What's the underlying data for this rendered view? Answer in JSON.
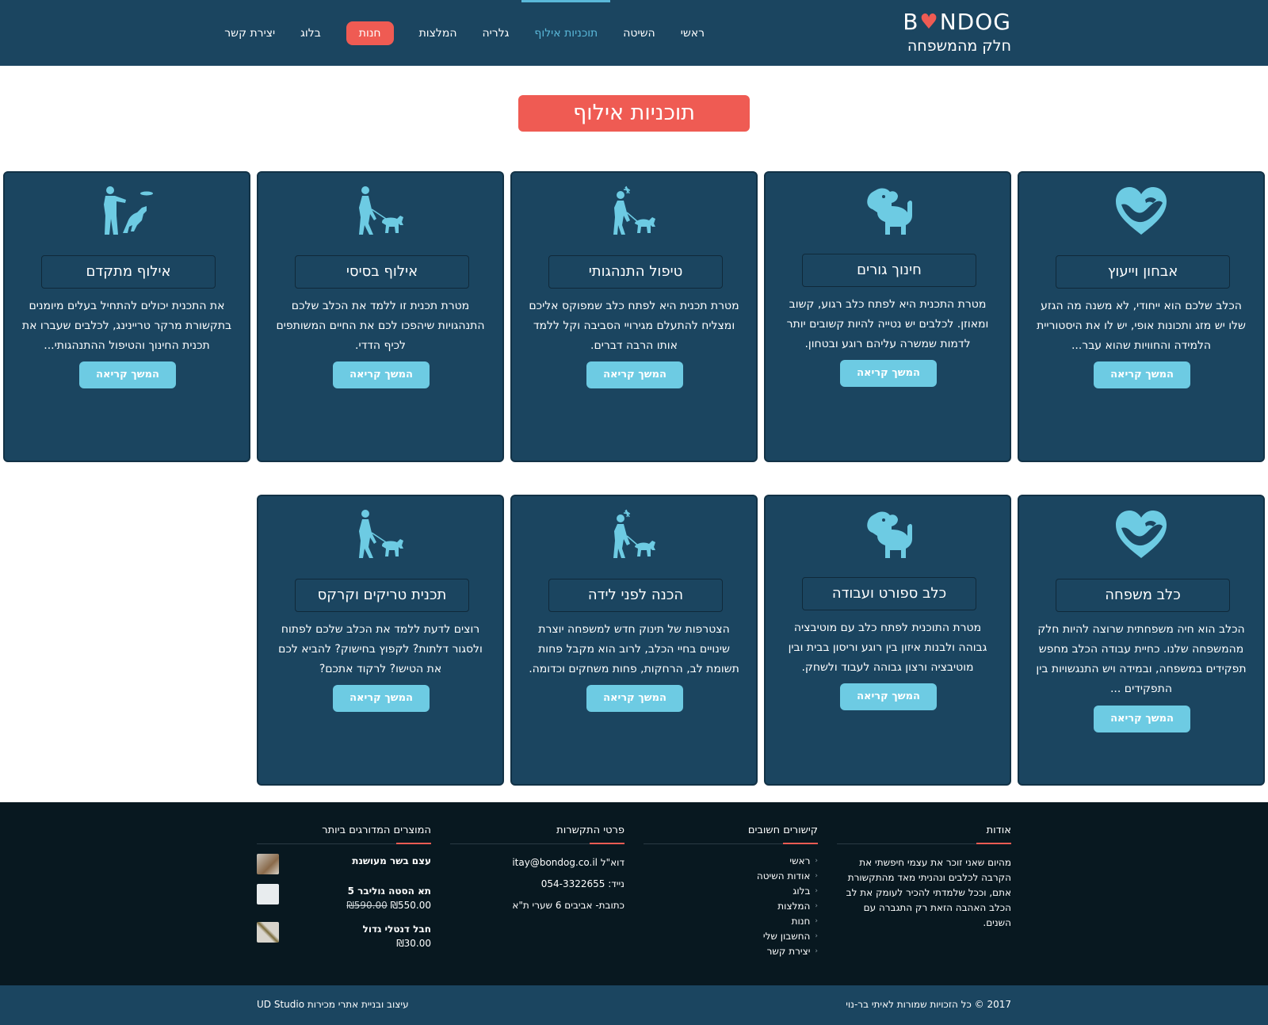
{
  "header": {
    "logo_brand_pre": "B",
    "logo_brand_post": "ND",
    "logo_brand_end": "OG",
    "logo_tagline": "חלק מהמשפחה",
    "nav": [
      {
        "label": "ראשי"
      },
      {
        "label": "השיטה"
      },
      {
        "label": "תוכניות אילוף"
      },
      {
        "label": "גלריה"
      },
      {
        "label": "המלצות"
      },
      {
        "label": "חנות"
      },
      {
        "label": "בלוג"
      },
      {
        "label": "יצירת קשר"
      }
    ]
  },
  "page_title": "תוכניות אילוף",
  "read_more": "המשך קריאה",
  "cards": [
    {
      "title": "אבחון וייעוץ",
      "icon": "heart-dog-icon",
      "desc": "הכלב שלכם הוא ייחודי, לא משנה מה הגזע שלו יש מזג ותכונות אופי, יש לו את היסטוריית הלמידה והחוויות שהוא עבר..."
    },
    {
      "title": "חינוך גורים",
      "icon": "puppy-icon",
      "desc": "מטרת התכנית היא לפתח כלב רגוע, קשוב ומאוזן. לכלבים יש נטייה להיות קשובים יותר לדמות שמשרה עליהם רוגע ובטחון."
    },
    {
      "title": "טיפול התנהגותי",
      "icon": "person-dog-bark-icon",
      "desc": "מטרת תכנית היא לפתח כלב שמפוקס אליכם ומצליח להתעלם מגירויי הסביבה וקל ללמד אותו הרבה דברים."
    },
    {
      "title": "אילוף בסיסי",
      "icon": "person-walking-dog-icon",
      "desc": "מטרת תכנית זו ללמד את הכלב שלכם התנהגויות שיהפכו לכם את החיים המשותפים לכיף הדדי."
    },
    {
      "title": "אילוף מתקדם",
      "icon": "frisbee-dog-icon",
      "desc": "את התכנית יכולים להתחיל בעלים מיומנים בתקשורת מרקר טריינינג, לכלבים שעברו את תכנית החינוך והטיפול ההתנהגותי..."
    },
    {
      "title": "כלב משפחה",
      "icon": "heart-dog-icon",
      "desc": "הכלב הוא חיה משפחתית שרוצה להיות חלק מהמשפחה שלנו. כחיית עבודה הכלב מחפש תפקידים במשפחה, ובמידה ויש התנגשויות בין התפקידים ..."
    },
    {
      "title": "כלב ספורט ועבודה",
      "icon": "puppy-icon",
      "desc": "מטרת התוכנית לפתח כלב עם מוטיבציה גבוהה ולבנות איזון בין רוגע וריסון בבית ובין מוטיבציה ורצון גבוהה לעבוד ולשחק."
    },
    {
      "title": "הכנה לפני לידה",
      "icon": "person-dog-bark-icon",
      "desc": "הצטרפות של תינוק חדש למשפחה יוצרת שינויים בחיי הכלב, לרוב הוא מקבל פחות תשומת לב, הרחקות, פחות משחקים וכדומה."
    },
    {
      "title": "תכנית טריקים וקרקס",
      "icon": "person-walking-dog-icon",
      "desc": "רוצים לדעת ללמד את הכלב שלכם לפתוח ולסגור דלתות? לקפוץ בחישוק? להביא לכם את הטישו? לרקוד אתכם?"
    }
  ],
  "footer": {
    "about": {
      "heading": "אודות",
      "text": "מהיום שאני זוכר את עצמי חיפשתי את הקרבה לכלבים ונהניתי מאד מהתקשורת אתם, וככל שלמדתי להכיר לעומק את לב הכלב האהבה הזאת רק התגברה עם השנים."
    },
    "links": {
      "heading": "קישורים חשובים",
      "items": [
        "ראשי",
        "אודות השיטה",
        "בלוג",
        "המלצות",
        "חנות",
        "החשבון שלי",
        "יצירת קשר"
      ]
    },
    "contact": {
      "heading": "פרטי התקשרות",
      "email": "דוא\"ל itay@bondog.co.il",
      "phone": "נייד: 054-3322655",
      "address": "כתובת- אביבים 6 שערי ת\"א"
    },
    "products": {
      "heading": "המוצרים המדורגים ביותר",
      "items": [
        {
          "name": "עצם בשר מעושנת",
          "price": "",
          "old_price": ""
        },
        {
          "name": "תא הסטה גוליבר 5",
          "price": "₪550.00",
          "old_price": "₪590.00"
        },
        {
          "name": "חבל דנטלי גדול",
          "price": "₪30.00",
          "old_price": ""
        }
      ]
    }
  },
  "bottom": {
    "copyright": "2017 © כל הזכויות שמורות לאיתי בר-נוי",
    "credit": "עיצוב ובניית אתרי מכירות UD Studio"
  },
  "colors": {
    "navy": "#1b4560",
    "coral": "#ef5b53",
    "light_blue": "#6dcbe3",
    "footer_dark": "#081820"
  }
}
